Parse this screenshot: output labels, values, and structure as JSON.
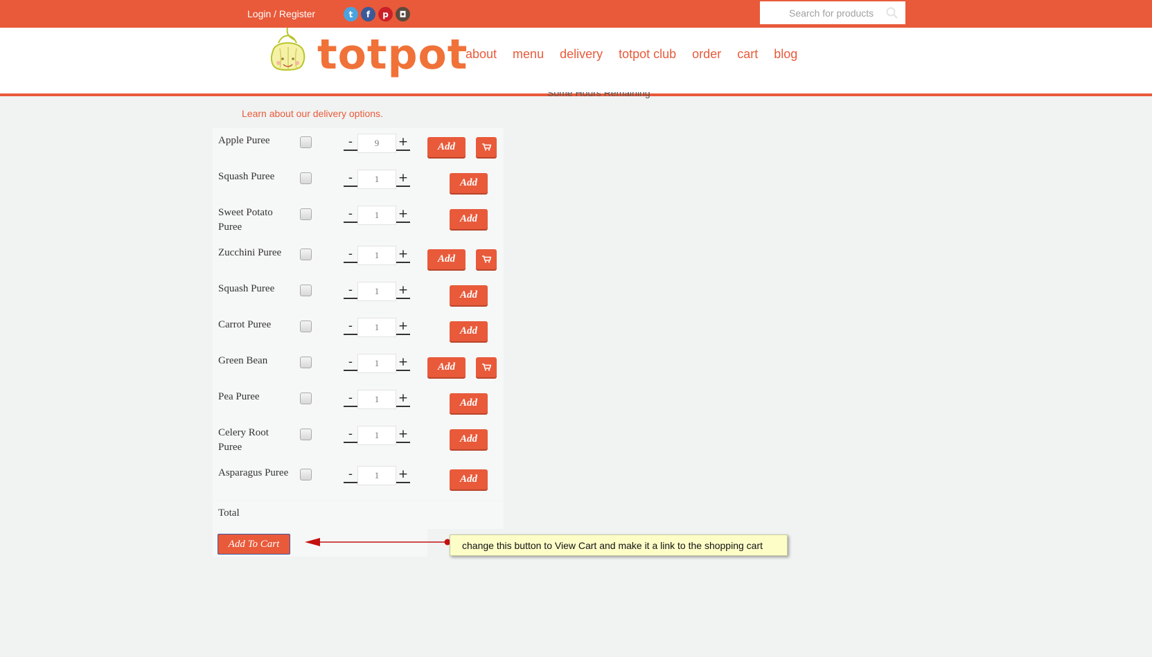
{
  "topbar": {
    "login_label": "Login / Register",
    "social": [
      {
        "icon": "twitter-icon",
        "color": "#4aa3df",
        "glyph": "t"
      },
      {
        "icon": "facebook-icon",
        "color": "#3b5998",
        "glyph": "f"
      },
      {
        "icon": "pinterest-icon",
        "color": "#cb2027",
        "glyph": "p"
      },
      {
        "icon": "instagram-icon",
        "color": "#5b4a3e",
        "glyph": "◘"
      }
    ],
    "search_placeholder": "Search for products"
  },
  "header": {
    "logo_text": "totpot",
    "nav": [
      "about",
      "menu",
      "delivery",
      "totpot club",
      "order",
      "cart",
      "blog"
    ],
    "remaining_text": "Some Hours Remaining"
  },
  "learn_link": "Learn about our delivery options.",
  "products": [
    {
      "name": "Apple Puree",
      "qty": "9",
      "add": "Add",
      "cart": true
    },
    {
      "name": "Squash Puree",
      "qty": "1",
      "add": "Add",
      "cart": false
    },
    {
      "name": "Sweet Potato Puree",
      "qty": "1",
      "add": "Add",
      "cart": false
    },
    {
      "name": "Zucchini Puree",
      "qty": "1",
      "add": "Add",
      "cart": true
    },
    {
      "name": "Squash Puree",
      "qty": "1",
      "add": "Add",
      "cart": false
    },
    {
      "name": "Carrot Puree",
      "qty": "1",
      "add": "Add",
      "cart": false
    },
    {
      "name": "Green Bean",
      "qty": "1",
      "add": "Add",
      "cart": true
    },
    {
      "name": "Pea Puree",
      "qty": "1",
      "add": "Add",
      "cart": false
    },
    {
      "name": "Celery Root Puree",
      "qty": "1",
      "add": "Add",
      "cart": false
    },
    {
      "name": "Asparagus Puree",
      "qty": "1",
      "add": "Add",
      "cart": false
    }
  ],
  "stepper": {
    "minus": "-",
    "plus": "+"
  },
  "total_label": "Total",
  "add_to_cart_label": "Add To Cart",
  "annotation": "change this button to View Cart and make it a link to the shopping cart",
  "colors": {
    "brand": "#e85a3a",
    "logo": "#f07238",
    "note_bg": "#fdfdc8"
  }
}
